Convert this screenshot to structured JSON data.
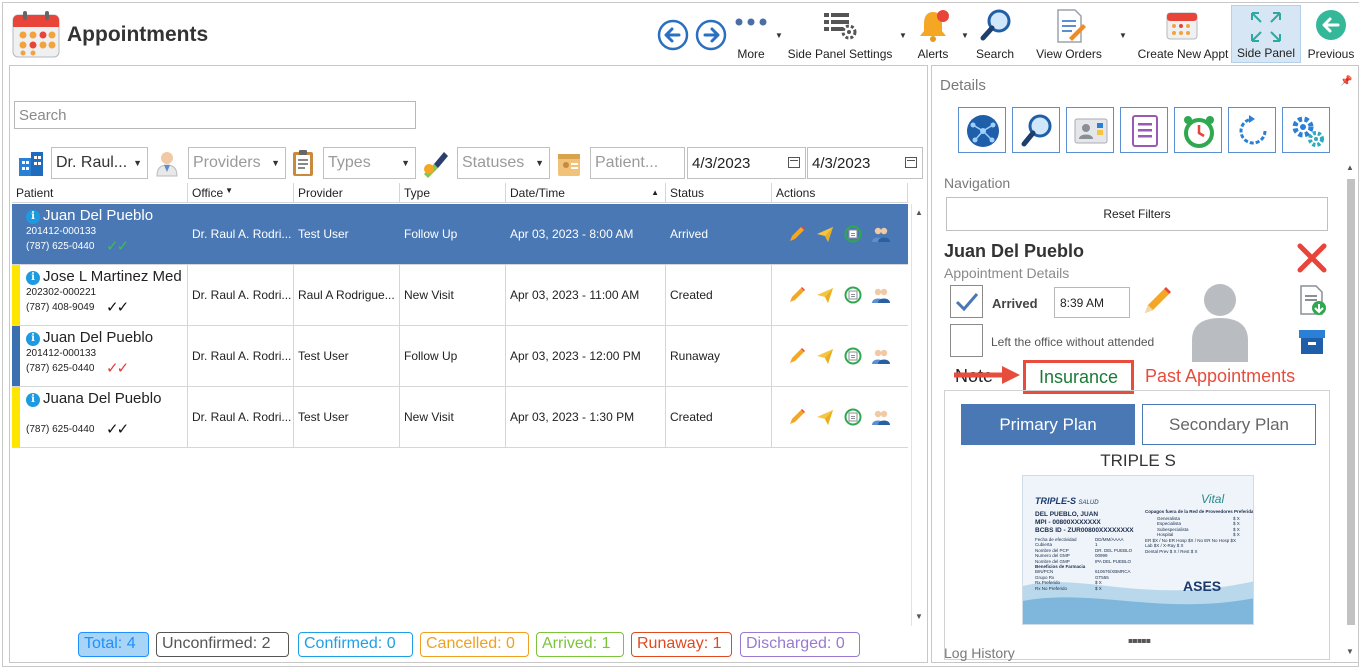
{
  "header": {
    "title": "Appointments",
    "toolbar": [
      {
        "name": "more",
        "label": "More",
        "icon": "more-dots-icon"
      },
      {
        "name": "side-panel-settings",
        "label": "Side Panel Settings",
        "icon": "table-gear-icon"
      },
      {
        "name": "alerts",
        "label": "Alerts",
        "icon": "bell-icon"
      },
      {
        "name": "search",
        "label": "Search",
        "icon": "magnifier-icon"
      },
      {
        "name": "view-orders",
        "label": "View Orders",
        "icon": "document-pen-icon"
      },
      {
        "name": "create-new-appt",
        "label": "Create New Appt",
        "icon": "calendar-icon"
      },
      {
        "name": "side-panel",
        "label": "Side Panel",
        "icon": "expand-arrows-icon",
        "active": true
      },
      {
        "name": "previous",
        "label": "Previous",
        "icon": "back-arrow-circle-icon"
      }
    ]
  },
  "search": {
    "placeholder": "Search"
  },
  "filters": {
    "doctor": "Dr. Raul...",
    "providers": "Providers",
    "types": "Types",
    "statuses": "Statuses",
    "patient": "Patient...",
    "date_from": "4/3/2023",
    "date_to": "4/3/2023"
  },
  "grid": {
    "columns": [
      "Patient",
      "Office",
      "Provider",
      "Type",
      "Date/Time",
      "Status",
      "Actions"
    ],
    "rows": [
      {
        "name": "Juan Del Pueblo",
        "id": "201412-000133",
        "phone": "(787) 625-0440",
        "checks": "✓✓",
        "office": "Dr. Raul A. Rodri...",
        "provider": "Test User",
        "type": "Follow Up",
        "datetime": "Apr 03, 2023 - 8:00 AM",
        "status": "Arrived",
        "flag_color": "#4a78b4",
        "check_color": "#3cc04a"
      },
      {
        "name": "Jose L Martinez Med",
        "id": "202302-000221",
        "phone": "(787) 408-9049",
        "checks": "✓✓",
        "office": "Dr. Raul A. Rodri...",
        "provider": "Raul A Rodrigue...",
        "type": "New Visit",
        "datetime": "Apr 03, 2023 - 11:00 AM",
        "status": "Created",
        "flag_color": "#ffe600",
        "check_color": "#111111"
      },
      {
        "name": "Juan Del Pueblo",
        "id": "201412-000133",
        "phone": "(787) 625-0440",
        "checks": "✓✓",
        "office": "Dr. Raul A. Rodri...",
        "provider": "Test User",
        "type": "Follow Up",
        "datetime": "Apr 03, 2023 - 12:00 PM",
        "status": "Runaway",
        "flag_color": "#3a6fb0",
        "check_color": "#e23b3b"
      },
      {
        "name": "Juana Del Pueblo",
        "id": "",
        "phone": "(787) 625-0440",
        "checks": "✓✓",
        "office": "Dr. Raul A. Rodri...",
        "provider": "Test User",
        "type": "New Visit",
        "datetime": "Apr 03, 2023 - 1:30 PM",
        "status": "Created",
        "flag_color": "#ffe600",
        "check_color": "#111111"
      }
    ]
  },
  "summary": [
    {
      "label": "Total: 4",
      "color": "#1e90ff",
      "bg": "#a8d4f7"
    },
    {
      "label": "Unconfirmed: 2",
      "color": "#555555",
      "bg": "#ffffff"
    },
    {
      "label": "Confirmed: 0",
      "color": "#1ea0e6",
      "bg": "#ffffff"
    },
    {
      "label": "Cancelled: 0",
      "color": "#f0a020",
      "bg": "#ffffff"
    },
    {
      "label": "Arrived: 1",
      "color": "#7cc43a",
      "bg": "#ffffff"
    },
    {
      "label": "Runaway: 1",
      "color": "#e04a20",
      "bg": "#ffffff"
    },
    {
      "label": "Discharged: 0",
      "color": "#9a7ad0",
      "bg": "#ffffff"
    }
  ],
  "details": {
    "title": "Details",
    "navigation_label": "Navigation",
    "reset_filters": "Reset Filters",
    "patient_name": "Juan Del Pueblo",
    "subtitle": "Appointment Details",
    "arrived_label": "Arrived",
    "arrived_checked": true,
    "arrived_time": "8:39 AM",
    "left_office_label": "Left the office without attended",
    "tabs": {
      "note": "Note",
      "insurance": "Insurance",
      "past": "Past Appointments"
    },
    "primary_plan": "Primary Plan",
    "secondary_plan": "Secondary Plan",
    "plan_name": "TRIPLE S",
    "log_history": "Log History",
    "card": {
      "brand": "TRIPLE-S",
      "brand_suffix": "SALUD",
      "vital": "Vital",
      "holder": "DEL PUEBLO, JUAN",
      "mpi": "MPI - 00800XXXXXXX",
      "bcbs": "BCBS ID - ZUR00800XXXXXXXX",
      "fields": [
        [
          "Fecha de efectividad",
          "DD/MM/AAAA"
        ],
        [
          "Cubierta",
          "1"
        ],
        [
          "Nombre del PCP",
          "DR. DEL PUEBLO"
        ],
        [
          "Numero del GMP",
          "00999"
        ],
        [
          "Nombre del GMP",
          "IPA DEL PUEBLO"
        ],
        [
          "Beneficios de Farmacia",
          ""
        ],
        [
          "BIN/PCN",
          "610676/XBMRCA"
        ],
        [
          "Grupo Rx",
          "GT555"
        ],
        [
          "Rx Preferido",
          "$ X"
        ],
        [
          "Rx No Preferido",
          "$ X"
        ]
      ],
      "copay_title": "Copagos fuera de la Red de Proveedores Preferida",
      "copays": [
        [
          "Generalista",
          "$ X"
        ],
        [
          "Especialista",
          "$ X"
        ],
        [
          "Subespecialista",
          "$ X"
        ],
        [
          "Hospital",
          "$ X"
        ]
      ],
      "copay_lines": [
        "ER $X / No ER Hosp $X / No ER No Hosp $X",
        "Lab $X / X-Ray $ X",
        "Dental Prev $ X / Rest $ X"
      ],
      "ases": "ASES"
    }
  }
}
